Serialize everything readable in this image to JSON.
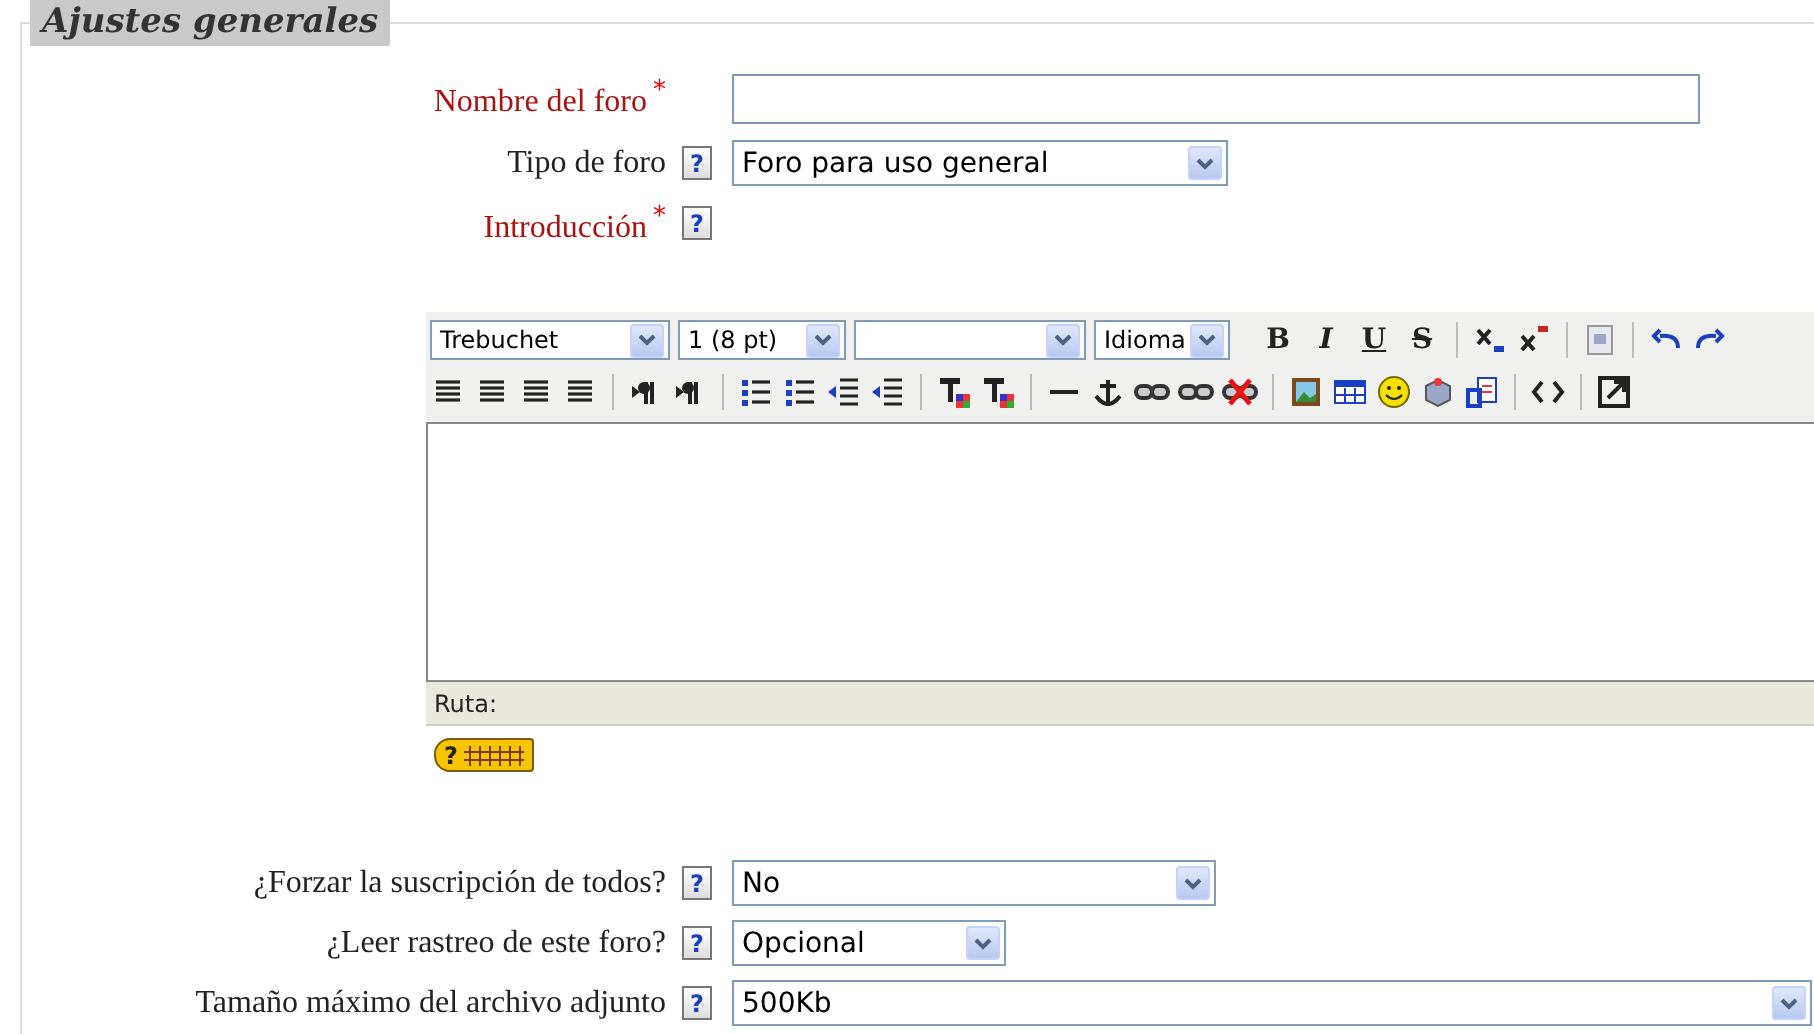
{
  "legend": "Ajustes generales",
  "top_fields": [
    {
      "kind": "text",
      "label": "Nombre del foro",
      "required": true,
      "required_mark": "*"
    },
    {
      "kind": "select",
      "label": "Tipo de foro",
      "required": false,
      "help": "?",
      "value": "Foro para uso general"
    },
    {
      "kind": "editor",
      "label": "Introducción",
      "required": true,
      "required_mark": "*",
      "help": "?"
    }
  ],
  "editor": {
    "selects": [
      {
        "kind": "value",
        "value": "Trebuchet"
      },
      {
        "kind": "value",
        "value": "1 (8 pt)"
      },
      {
        "kind": "blank"
      },
      {
        "kind": "value",
        "value": "Idioma"
      }
    ],
    "format_buttons": [
      "B",
      "I",
      "U",
      "S"
    ],
    "path_label": "Ruta:",
    "help_badge": "?"
  },
  "bottom_fields": [
    {
      "kind": "select",
      "label": "¿Forzar la suscripción de todos?",
      "required": false,
      "help": "?",
      "value": "No"
    },
    {
      "kind": "select",
      "label": "¿Leer rastreo de este foro?",
      "required": false,
      "help": "?",
      "value": "Opcional"
    },
    {
      "kind": "select",
      "label": "Tamaño máximo del archivo adjunto",
      "required": false,
      "help": "?",
      "value": "500Kb"
    }
  ]
}
